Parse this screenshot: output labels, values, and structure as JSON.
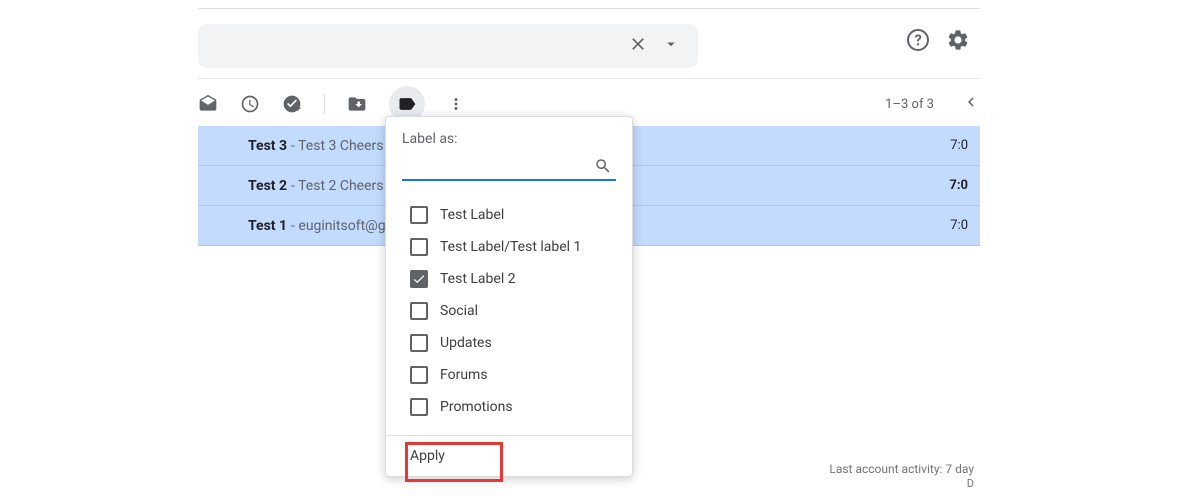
{
  "toolbar": {
    "count_label": "1–3 of 3"
  },
  "emails": [
    {
      "subject": "Test 3",
      "preview": " - Test 3 Cheers",
      "time": "7:0",
      "bold": false
    },
    {
      "subject": "Test 2",
      "preview": " - Test 2 Cheers",
      "time": "7:0",
      "bold": true
    },
    {
      "subject": "Test 1",
      "preview": " - euginitsoft@g",
      "time": "7:0",
      "bold": false
    }
  ],
  "popup": {
    "title": "Label as:",
    "search_placeholder": "",
    "apply_label": "Apply",
    "labels": [
      {
        "name": "Test Label",
        "checked": false
      },
      {
        "name": "Test Label/Test label 1",
        "checked": false
      },
      {
        "name": "Test Label 2",
        "checked": true
      },
      {
        "name": "Social",
        "checked": false
      },
      {
        "name": "Updates",
        "checked": false
      },
      {
        "name": "Forums",
        "checked": false
      },
      {
        "name": "Promotions",
        "checked": false
      }
    ]
  },
  "footer": {
    "activity": "Last account activity: 7 day",
    "small": "D"
  }
}
